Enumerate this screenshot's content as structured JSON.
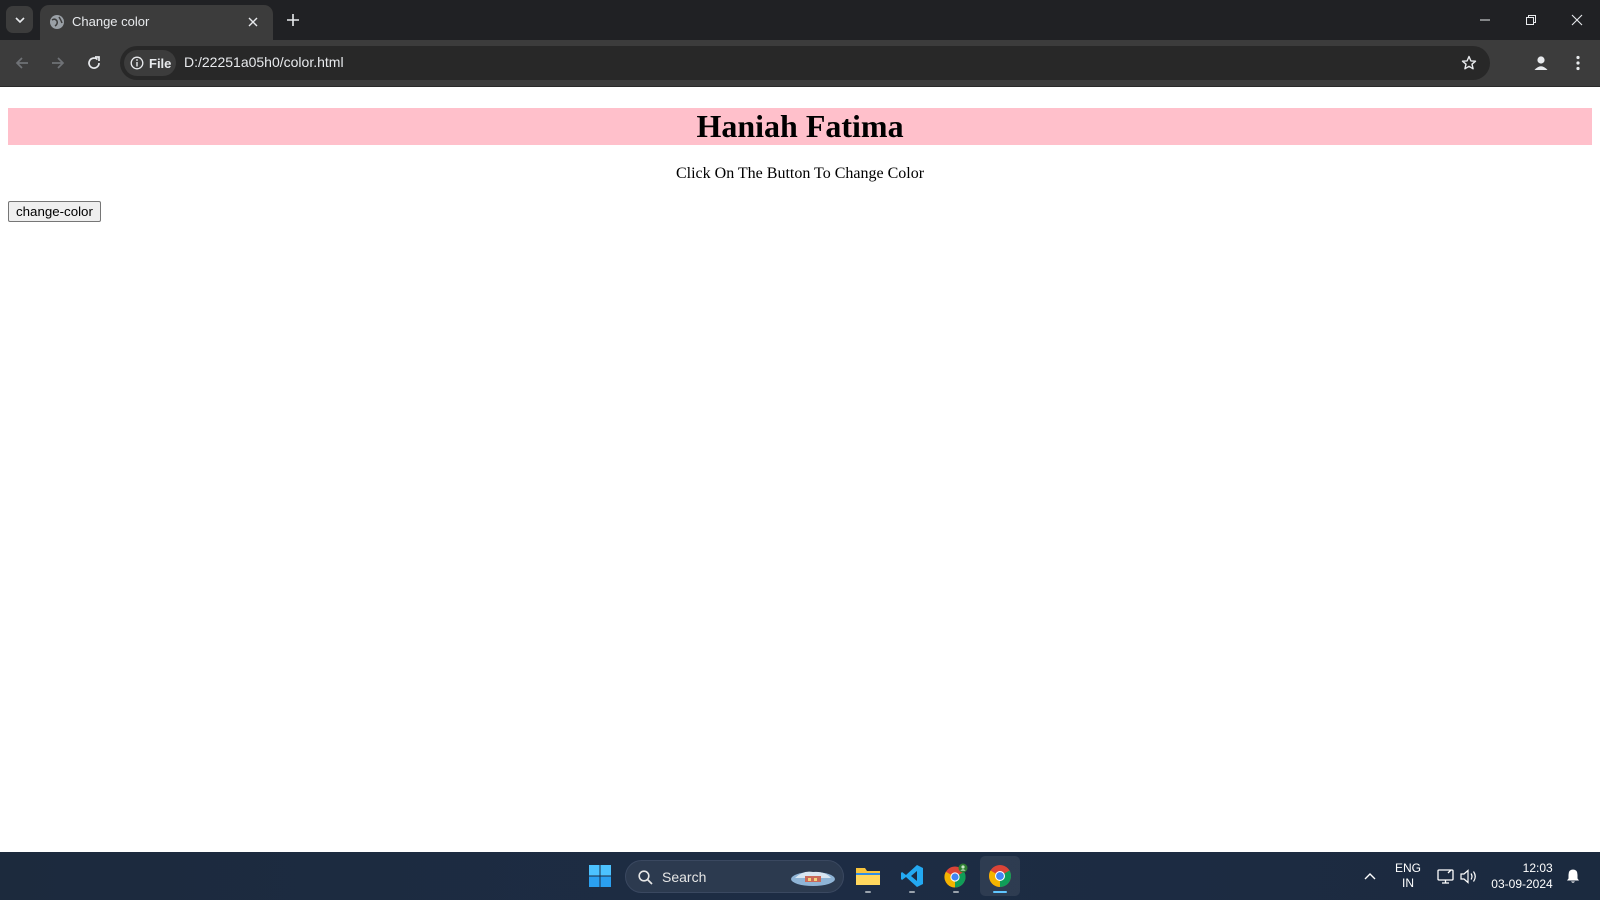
{
  "browser": {
    "tab": {
      "title": "Change color"
    },
    "omnibox": {
      "scheme_chip": "File",
      "url": "D:/22251a05h0/color.html"
    }
  },
  "page": {
    "heading": "Haniah Fatima",
    "subtitle": "Click On The Button To Change Color",
    "button_label": "change-color"
  },
  "taskbar": {
    "search_label": "Search",
    "language": {
      "line1": "ENG",
      "line2": "IN"
    },
    "time": "12:03",
    "date": "03-09-2024"
  },
  "colors": {
    "heading_bg": "#ffc0cb",
    "chrome_dark": "#202124",
    "toolbar": "#3c3c3c",
    "taskbar": "#1d2c44"
  },
  "icons": [
    "tab-search-icon",
    "globe-icon",
    "close-icon",
    "plus-icon",
    "minimize-icon",
    "restore-icon",
    "back-icon",
    "forward-icon",
    "reload-icon",
    "info-icon",
    "star-icon",
    "profile-icon",
    "menu-icon",
    "windows-start-icon",
    "search-icon",
    "file-explorer-icon",
    "vscode-icon",
    "chrome-profile-icon",
    "chrome-icon",
    "chevron-up-icon",
    "network-icon",
    "volume-icon",
    "bell-icon"
  ]
}
